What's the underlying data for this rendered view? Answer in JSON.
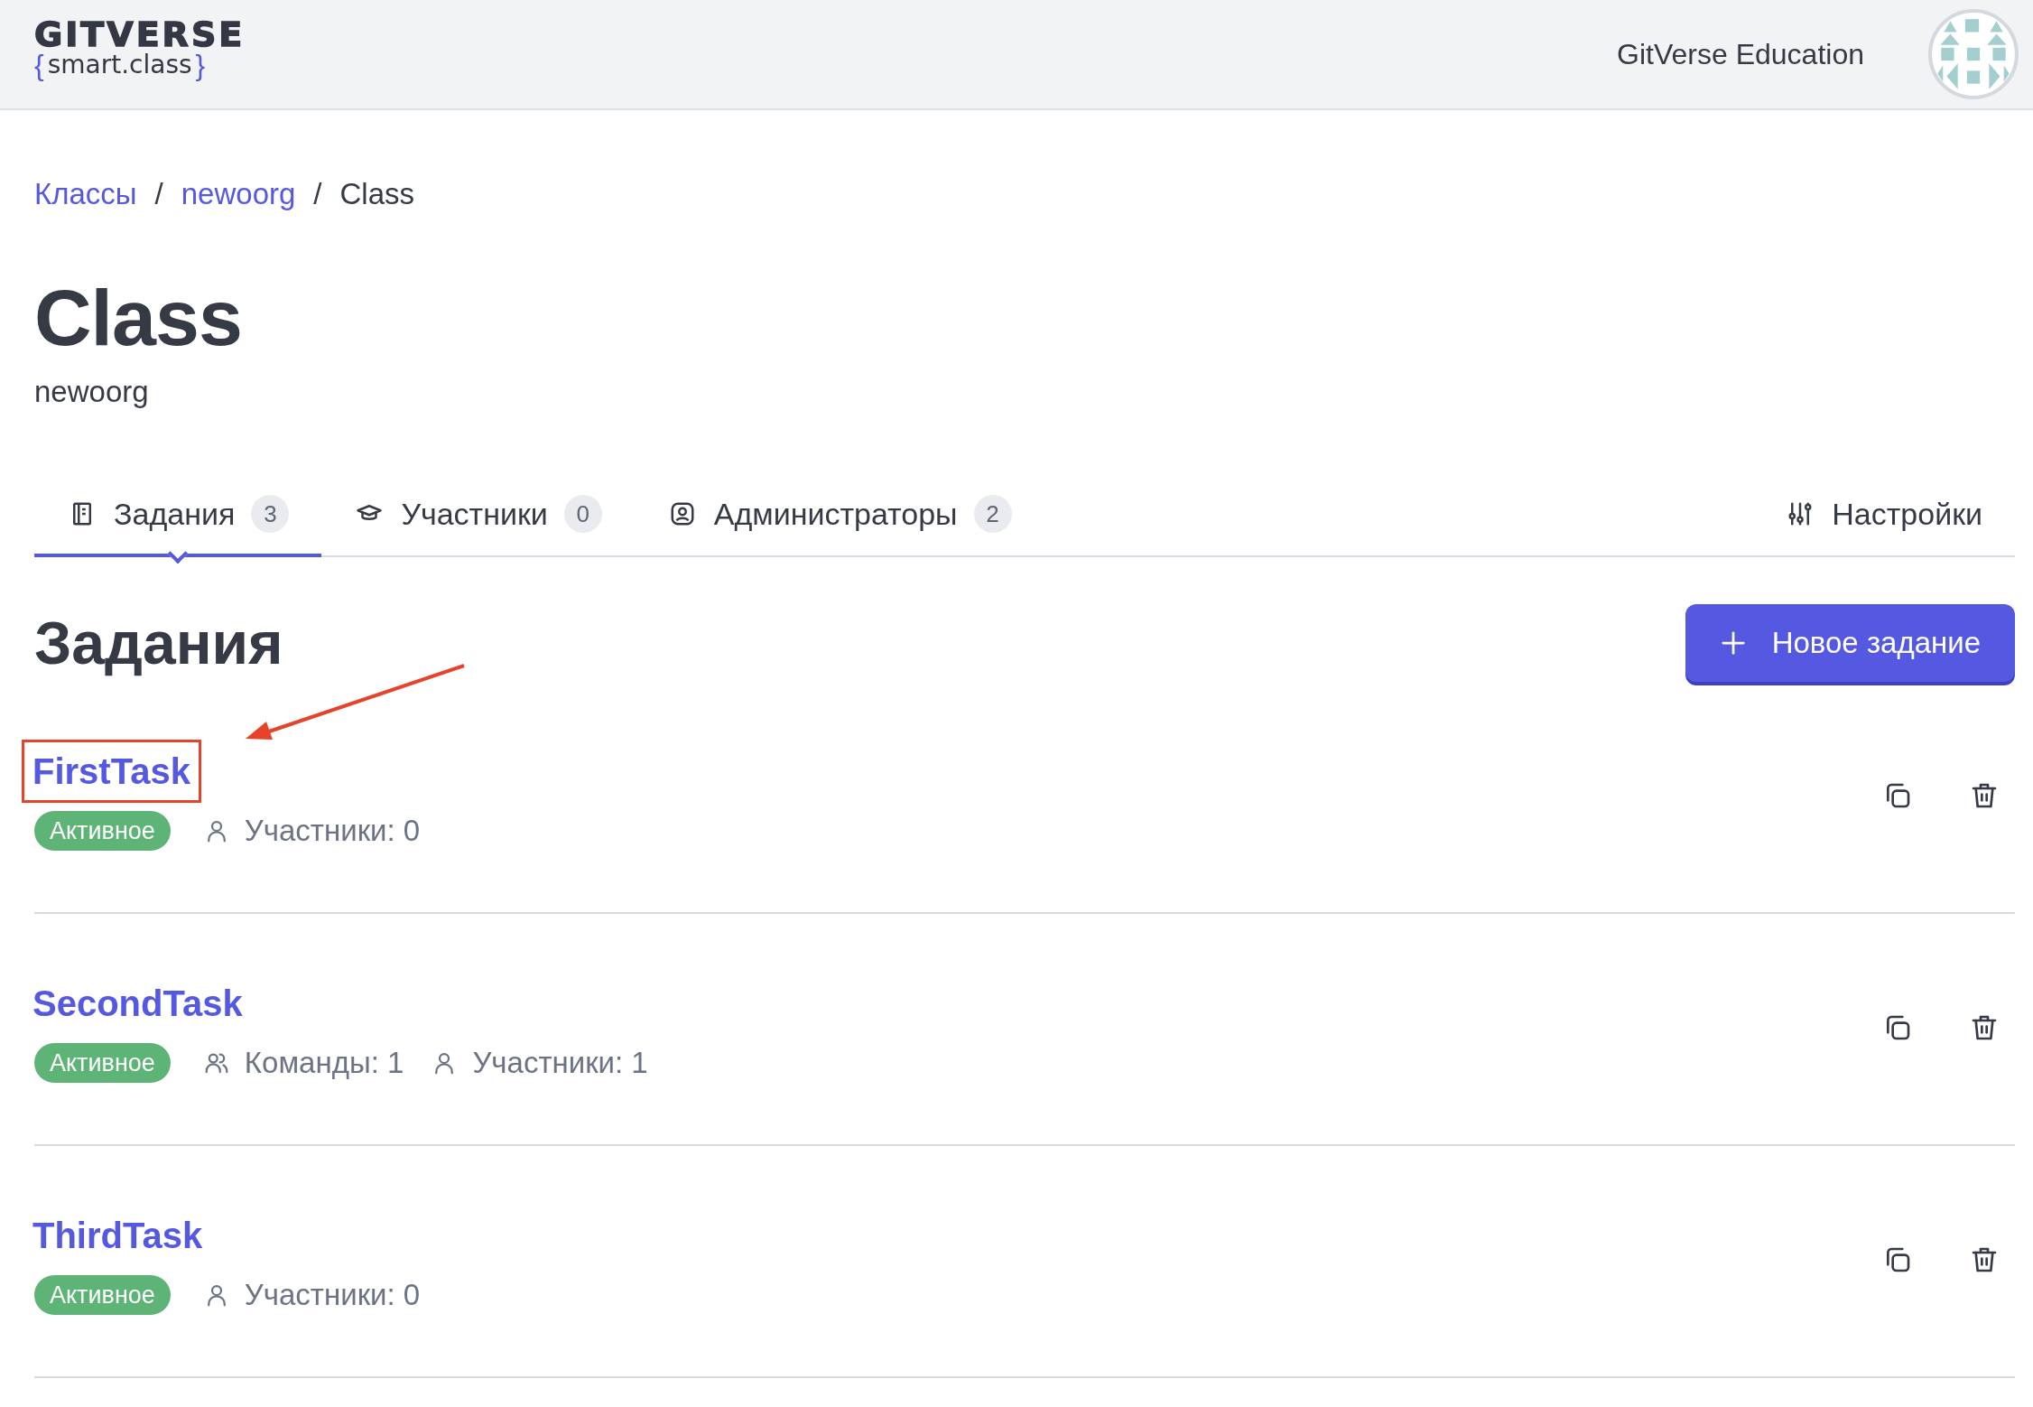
{
  "header": {
    "logo_title": "GITVERSE",
    "logo_open": "{",
    "logo_text": "smart.class",
    "logo_close": "}",
    "org_name": "GitVerse Education"
  },
  "breadcrumbs": [
    {
      "label": "Классы",
      "kind": "link"
    },
    {
      "label": "/",
      "kind": "separator"
    },
    {
      "label": "newoorg",
      "kind": "link"
    },
    {
      "label": "/",
      "kind": "separator"
    },
    {
      "label": "Class",
      "kind": "current"
    }
  ],
  "title": "Class",
  "subtitle": "newoorg",
  "tabs": [
    {
      "label": "Задания",
      "count": "3",
      "selected": true
    },
    {
      "label": "Участники",
      "count": "0",
      "selected": false
    },
    {
      "label": "Администраторы",
      "count": "2",
      "selected": false
    }
  ],
  "settings_tab": {
    "label": "Настройки"
  },
  "section_title": "Задания",
  "new_button": {
    "label": "Новое задание"
  },
  "tasks": [
    {
      "name": "FirstTask",
      "status": "Активное",
      "highlighted": true,
      "meta": [
        {
          "kind": "members",
          "text": "Участники: 0"
        }
      ]
    },
    {
      "name": "SecondTask",
      "status": "Активное",
      "highlighted": false,
      "meta": [
        {
          "kind": "teams",
          "text": "Команды: 1"
        },
        {
          "kind": "members",
          "text": "Участники: 1"
        }
      ]
    },
    {
      "name": "ThirdTask",
      "status": "Активное",
      "highlighted": false,
      "meta": [
        {
          "kind": "members",
          "text": "Участники: 0"
        }
      ]
    }
  ]
}
